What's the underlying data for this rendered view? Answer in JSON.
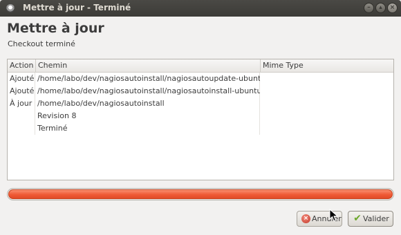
{
  "window": {
    "title": "Mettre à jour - Terminé"
  },
  "header": {
    "title": "Mettre à jour",
    "subtitle": "Checkout terminé"
  },
  "table": {
    "columns": [
      "Action",
      "Chemin",
      "Mime Type"
    ],
    "rows": [
      {
        "action": "Ajouté",
        "chemin": "/home/labo/dev/nagiosautoinstall/nagiosautoupdate-ubuntu.sh",
        "mime": ""
      },
      {
        "action": "Ajouté",
        "chemin": "/home/labo/dev/nagiosautoinstall/nagiosautoinstall-ubuntu.sh",
        "mime": ""
      },
      {
        "action": "À jour",
        "chemin": "/home/labo/dev/nagiosautoinstall",
        "mime": ""
      },
      {
        "action": "",
        "chemin": "Revision 8",
        "mime": ""
      },
      {
        "action": "",
        "chemin": "Terminé",
        "mime": ""
      }
    ]
  },
  "progress": {
    "value": 1.0,
    "fill_color": "#ef5a35"
  },
  "buttons": {
    "cancel_label": "Annuler",
    "cancel_icon": "cancel-icon",
    "ok_label": "Valider",
    "ok_icon": "checkmark-icon"
  }
}
